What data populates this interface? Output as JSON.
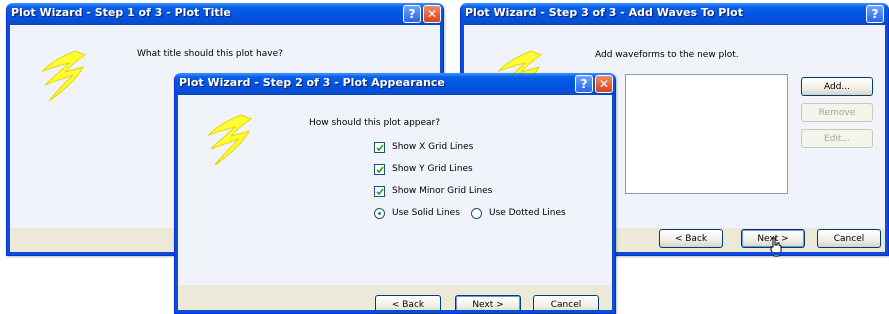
{
  "colors": {
    "titlebar": "#0054e3",
    "panel": "#f1f3fb",
    "client": "#ece9d8",
    "bolt": "#ffff33"
  },
  "step1": {
    "title": "Plot Wizard - Step 1 of 3 - Plot Title",
    "prompt": "What title should this plot have?",
    "help": "?",
    "close": "✕"
  },
  "step3": {
    "title": "Plot Wizard - Step 3 of 3 - Add Waves To Plot",
    "prompt": "Add waveforms to the new plot.",
    "help": "?",
    "add": "Add...",
    "remove": "Remove",
    "edit": "Edit...",
    "back": "< Back",
    "next": "Next >",
    "cancel": "Cancel"
  },
  "step2": {
    "title": "Plot Wizard - Step 2 of 3 - Plot Appearance",
    "prompt": "How should this plot appear?",
    "help": "?",
    "close": "✕",
    "options": {
      "show_x_grid": {
        "label": "Show X Grid Lines",
        "checked": true
      },
      "show_y_grid": {
        "label": "Show Y Grid Lines",
        "checked": true
      },
      "show_minor_grid": {
        "label": "Show Minor Grid Lines",
        "checked": true
      }
    },
    "line_style": {
      "solid": {
        "label": "Use Solid Lines",
        "selected": true
      },
      "dotted": {
        "label": "Use Dotted Lines",
        "selected": false
      }
    },
    "back": "< Back",
    "next": "Next >",
    "cancel": "Cancel"
  }
}
